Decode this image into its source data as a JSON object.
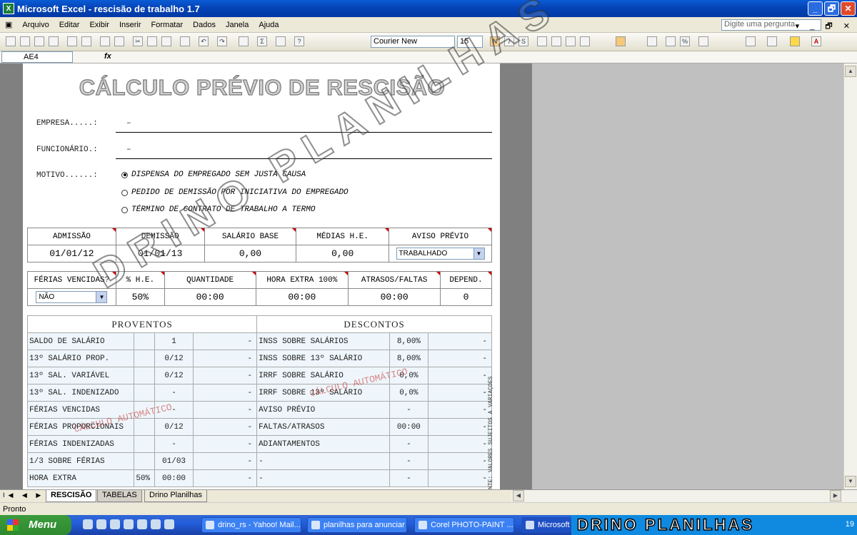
{
  "window": {
    "title": "Microsoft Excel - rescisão de trabalho 1.7",
    "min": "_",
    "max": "🗗",
    "close": "✕"
  },
  "menu": {
    "items": [
      "Arquivo",
      "Editar",
      "Exibir",
      "Inserir",
      "Formatar",
      "Dados",
      "Janela",
      "Ajuda"
    ],
    "ask": "Digite uma pergunta",
    "right_controls": "▾ _ 🗗 ✕"
  },
  "toolbar": {
    "font": "Courier New",
    "size": "15"
  },
  "formula": {
    "cell": "AE4",
    "fx": "fx"
  },
  "sheet": {
    "title": "CÁLCULO PRÉVIO DE RESCISÃO",
    "empresa_label": "EMPRESA.....:",
    "empresa_value": "–",
    "funcionario_label": "FUNCIONÁRIO.:",
    "funcionario_value": "–",
    "motivo_label": "MOTIVO......:",
    "motivos": [
      "DISPENSA DO EMPREGADO SEM JUSTA CAUSA",
      "PEDIDO DE DEMISSÃO POR INICIATIVA DO EMPREGADO",
      "TÉRMINO DE CONTRATO DE TRABALHO A TERMO"
    ],
    "box1": {
      "headers": [
        "ADMISSÃO",
        "DEMISSÃO",
        "SALÁRIO BASE",
        "MÉDIAS H.E.",
        "AVISO PRÉVIO"
      ],
      "values": [
        "01/01/12",
        "01/01/13",
        "0,00",
        "0,00"
      ],
      "aviso_value": "TRABALHADO"
    },
    "box2": {
      "headers": [
        "FÉRIAS VENCIDAS?",
        "% H.E.",
        "QUANTIDADE",
        "HORA EXTRA 100%",
        "ATRASOS/FALTAS",
        "DEPEND."
      ],
      "ferias_value": "NÃO",
      "values": [
        "50%",
        "00:00",
        "00:00",
        "00:00",
        "0"
      ]
    },
    "proventos_header": "PROVENTOS",
    "descontos_header": "DESCONTOS",
    "rows": [
      {
        "p": "SALDO DE SALÁRIO",
        "pe": "",
        "pq": "1",
        "pv": "-",
        "d": "INSS SOBRE SALÁRIOS",
        "dq": "8,00%",
        "dv": "-"
      },
      {
        "p": "13º SALÁRIO PROP.",
        "pe": "",
        "pq": "0/12",
        "pv": "-",
        "d": "INSS SOBRE 13º SALÁRIO",
        "dq": "8,00%",
        "dv": "-"
      },
      {
        "p": "13º SAL. VARIÁVEL",
        "pe": "",
        "pq": "0/12",
        "pv": "-",
        "d": "IRRF SOBRE SALÁRIO",
        "dq": "0,0%",
        "dv": "-"
      },
      {
        "p": "13º SAL. INDENIZADO",
        "pe": "",
        "pq": "-",
        "pv": "-",
        "d": "IRRF SOBRE 13º SALÁRIO",
        "dq": "0,0%",
        "dv": "-"
      },
      {
        "p": "FÉRIAS VENCIDAS",
        "pe": "",
        "pq": "-",
        "pv": "-",
        "d": "AVISO PRÉVIO",
        "dq": "-",
        "dv": "-"
      },
      {
        "p": "FÉRIAS PROPORCIONAIS",
        "pe": "",
        "pq": "0/12",
        "pv": "-",
        "d": "FALTAS/ATRASOS",
        "dq": "00:00",
        "dv": "-"
      },
      {
        "p": "FÉRIAS INDENIZADAS",
        "pe": "",
        "pq": "-",
        "pv": "-",
        "d": "ADIANTAMENTOS",
        "dq": "-",
        "dv": "-"
      },
      {
        "p": "1/3 SOBRE FÉRIAS",
        "pe": "",
        "pq": "01/03",
        "pv": "-",
        "d": "-",
        "dq": "-",
        "dv": "-"
      },
      {
        "p": "HORA EXTRA",
        "pe": "50%",
        "pq": "00:00",
        "pv": "-",
        "d": "-",
        "dq": "-",
        "dv": "-"
      }
    ],
    "side_note": "NTE: VALORES SUJEITOS A VARIAÇÕES",
    "auto_label": "CÁLCULO AUTOMÁTICO",
    "watermark": "DRINO PLANILHAS"
  },
  "tabs": [
    "RESCISÃO",
    "TABELAS",
    "Drino Planilhas"
  ],
  "tab_nav": "I◀ ◀ ▶ ▶I",
  "status": "Pronto",
  "taskbar": {
    "start": "Menu",
    "tasks": [
      "drino_rs - Yahoo! Mail...",
      "planilhas para anunciar",
      "Corel PHOTO-PAINT ...",
      "Microsoft Ex..."
    ],
    "tray_watermark": "DRINO PLANILHAS",
    "clock": "19"
  }
}
